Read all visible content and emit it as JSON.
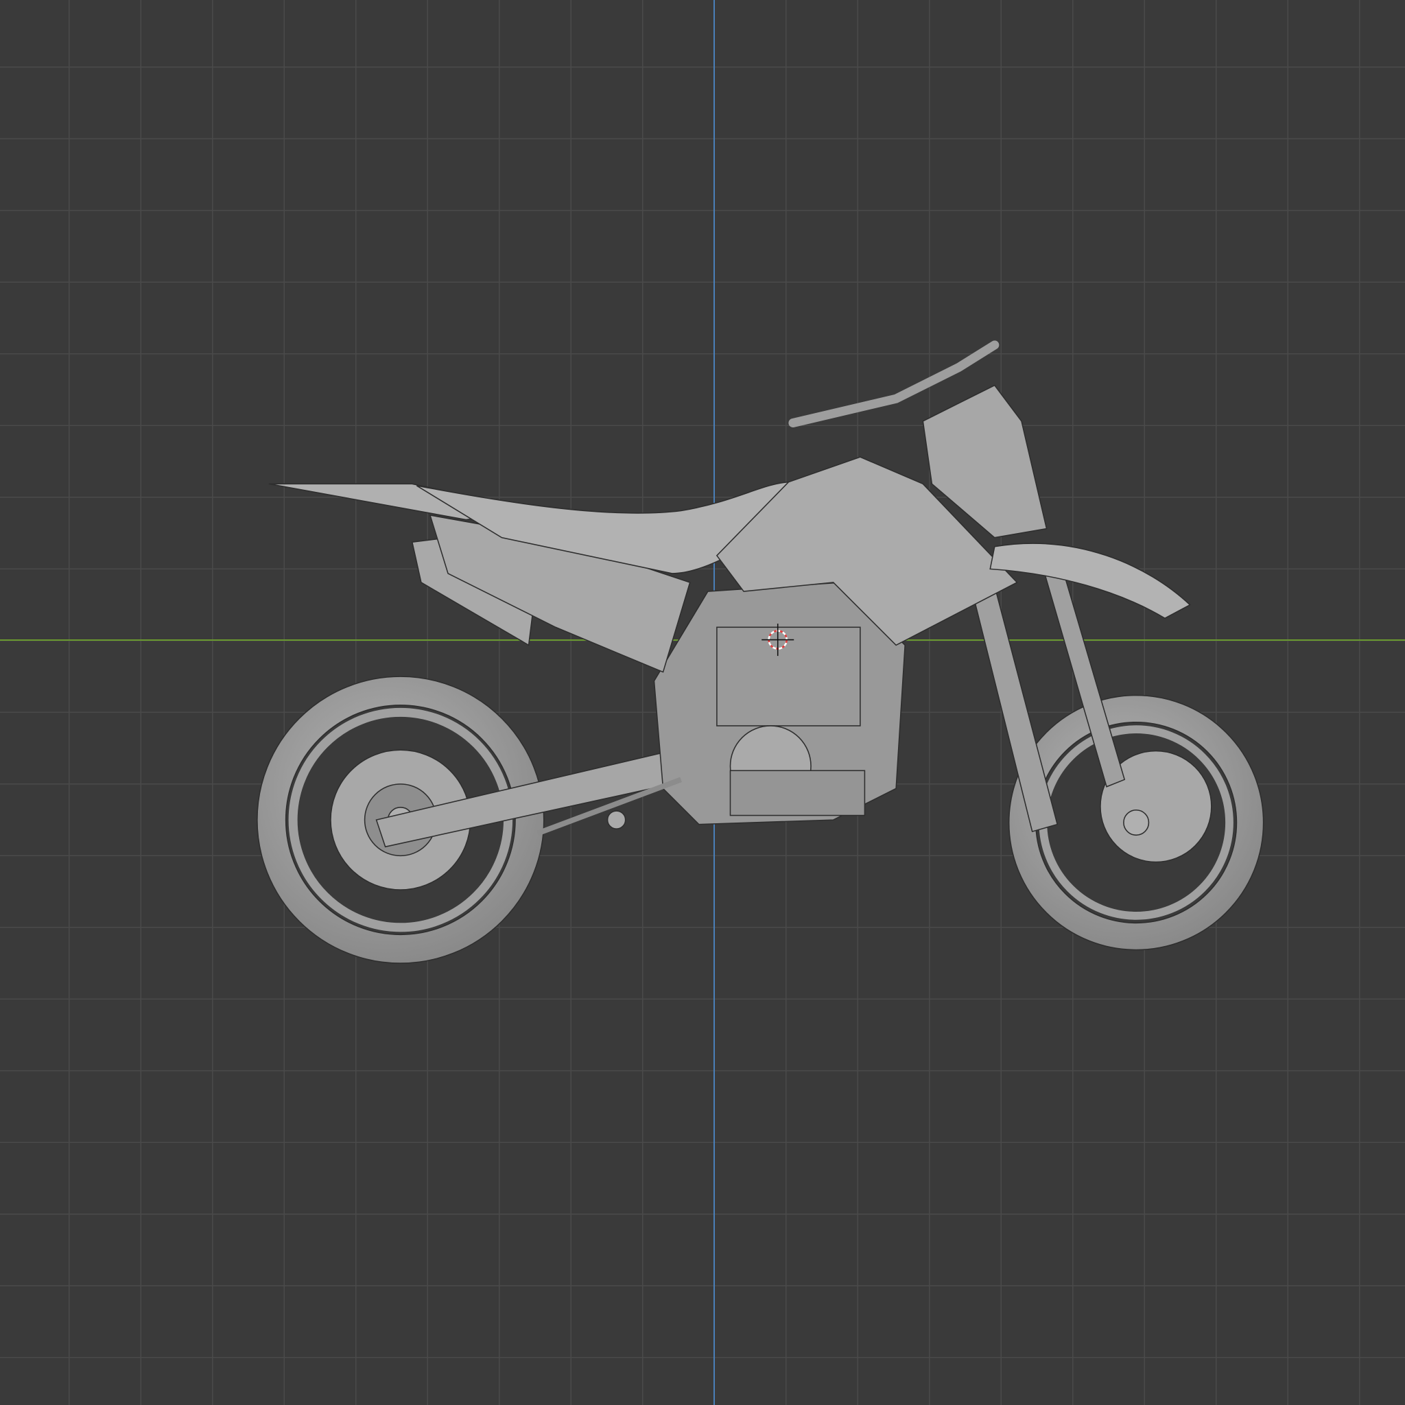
{
  "viewport": {
    "background_color": "#3a3a3a",
    "grid_color": "#4a4a4a",
    "x_axis_color": "#6a9a30",
    "y_axis_color": "#4a7fb8",
    "model_color": "#9e9e9e",
    "cursor_icon": "3d-cursor-icon"
  }
}
